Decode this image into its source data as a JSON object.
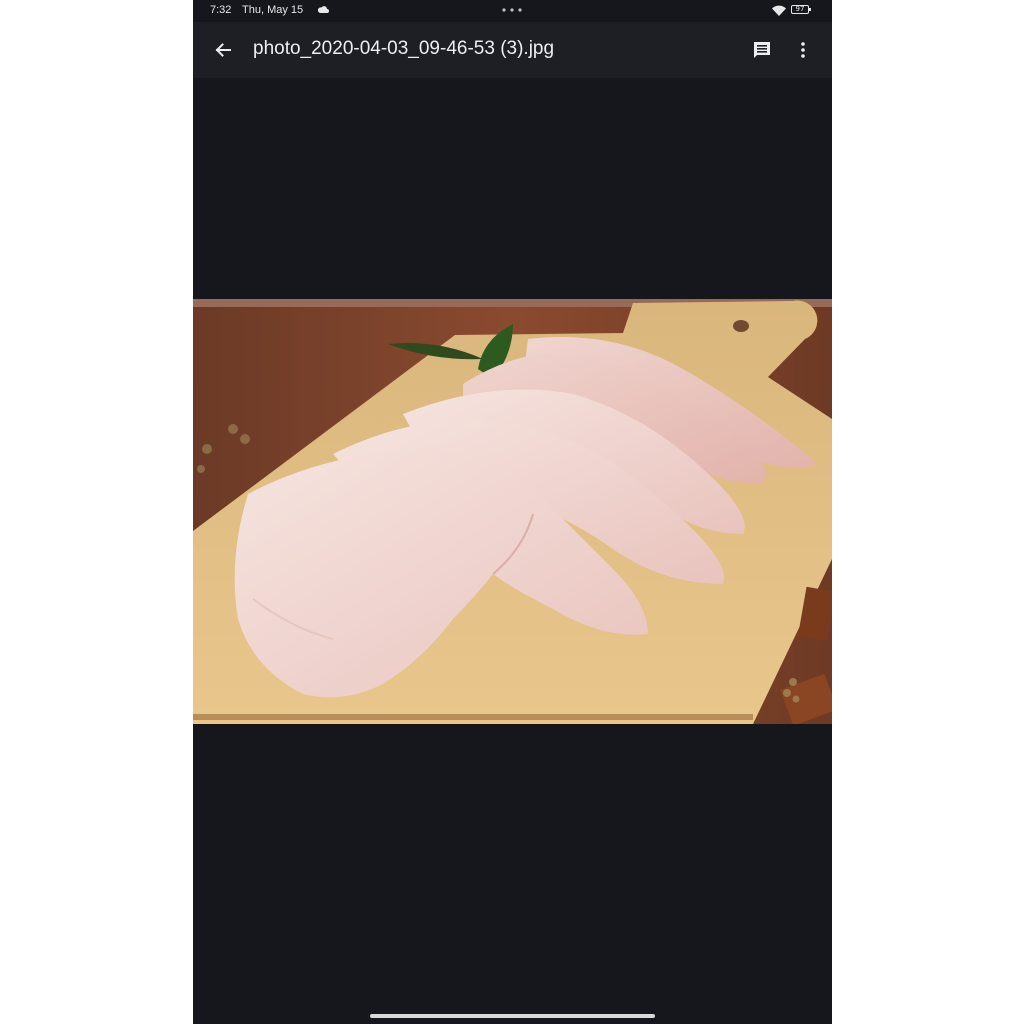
{
  "status_bar": {
    "time": "7:32",
    "date": "Thu, May 15",
    "weather_icon": "cloud-icon",
    "more_icon": "three-dots-icon",
    "wifi_icon": "wifi-icon",
    "battery_level": "97"
  },
  "app_bar": {
    "back_icon": "arrow-back-icon",
    "title": "photo_2020-04-03_09-46-53 (3).jpg",
    "comment_icon": "comment-icon",
    "more_icon": "more-vertical-icon"
  },
  "photo": {
    "subject": "raw chicken wings on wooden cutting board",
    "alt": "photo_2020-04-03_09-46-53 (3).jpg"
  },
  "colors": {
    "background": "#15171c",
    "app_bar": "#1d1f25",
    "text": "#eceef2"
  }
}
